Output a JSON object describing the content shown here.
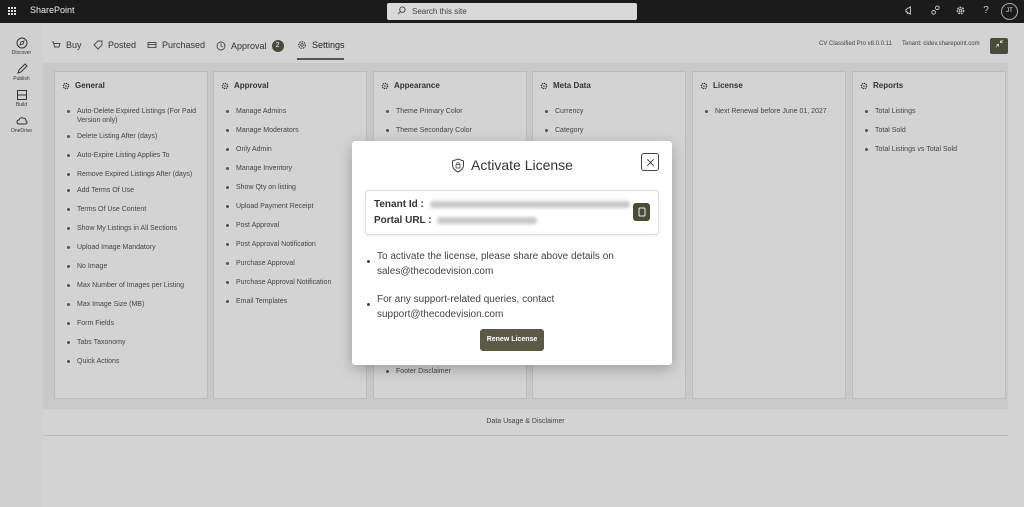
{
  "app": {
    "title": "SharePoint",
    "search_placeholder": "Search this site",
    "user_initials": "JT"
  },
  "topbar_icons": [
    "megaphone-icon",
    "share-icon",
    "settings-icon",
    "help-icon"
  ],
  "rail": [
    {
      "label": "Discover",
      "icon": "compass-icon"
    },
    {
      "label": "Publish",
      "icon": "pencil-icon"
    },
    {
      "label": "Build",
      "icon": "build-icon"
    },
    {
      "label": "OneDrive",
      "icon": "cloud-icon"
    }
  ],
  "tabs": [
    {
      "label": "Buy",
      "icon": "cart-icon"
    },
    {
      "label": "Posted",
      "icon": "tag-icon"
    },
    {
      "label": "Purchased",
      "icon": "receipt-icon"
    },
    {
      "label": "Approval",
      "icon": "clock-icon",
      "badge": "2"
    },
    {
      "label": "Settings",
      "icon": "gear-icon",
      "active": true
    }
  ],
  "header": {
    "version": "CV Classified Pro v8.0.0.11",
    "tenant": "Tenant: cidev.sharepoint.com"
  },
  "cards": [
    {
      "title": "General",
      "items": [
        "Auto-Delete Expired Listings (For Paid Version only)",
        "Delete Listing After (days)",
        "Auto-Expire Listing Applies To",
        "Remove Expired Listings After (days)",
        "Add Terms Of Use",
        "Terms Of Use Content",
        "Show My Listings in All Sections",
        "Upload Image Mandatory",
        "No Image",
        "Max Number of Images per Listing",
        "Max Image Size (MB)",
        "Form Fields",
        "Tabs Taxonomy",
        "Quick Actions"
      ]
    },
    {
      "title": "Approval",
      "items": [
        "Manage Admins",
        "Manage Moderators",
        "Only Admin",
        "Manage Inventory",
        "Show Qty on listing",
        "Upload Payment Receipt",
        "Post Approval",
        "Post Approval Notification",
        "Purchase Approval",
        "Purchase Approval Notification",
        "Email Templates"
      ]
    },
    {
      "title": "Appearance",
      "items": [
        "Theme Primary Color",
        "Theme Secondary Color"
      ],
      "bottom_item": "Footer Disclaimer"
    },
    {
      "title": "Meta Data",
      "items": [
        "Currency",
        "Category"
      ]
    },
    {
      "title": "License",
      "items": [
        "Next Renewal before June 01, 2027"
      ]
    },
    {
      "title": "Reports",
      "items": [
        "Total Listings",
        "Total Sold",
        "Total Listings vs Total Sold"
      ]
    }
  ],
  "footer": {
    "label": "Data Usage & Disclaimer"
  },
  "modal": {
    "title": "Activate License",
    "tenant_label": "Tenant Id :",
    "portal_label": "Portal URL :",
    "messages": [
      "To activate the license, please share above details on sales@thecodevision.com",
      "For any support-related queries, contact support@thecodevision.com"
    ],
    "button": "Renew License"
  },
  "colors": {
    "accent": "#4b4b3b",
    "topbar": "#1b1b1b",
    "overlay": "#d0d0d0"
  }
}
